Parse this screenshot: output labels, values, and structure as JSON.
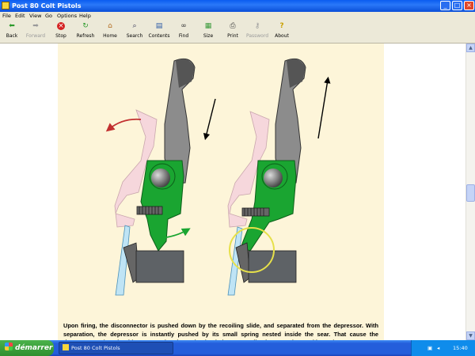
{
  "window": {
    "title": "Post 80 Colt Pistols"
  },
  "menu": [
    "File",
    "Edit",
    "View",
    "Go",
    "Options",
    "Help"
  ],
  "toolbar": [
    {
      "label": "Back",
      "icon": "back-arrow-icon",
      "enabled": true
    },
    {
      "label": "Forward",
      "icon": "forward-arrow-icon",
      "enabled": false
    },
    {
      "label": "Stop",
      "icon": "stop-icon",
      "enabled": true
    },
    {
      "label": "Refresh",
      "icon": "refresh-icon",
      "enabled": true
    },
    {
      "label": "Home",
      "icon": "home-icon",
      "enabled": true
    },
    {
      "label": "Search",
      "icon": "search-icon",
      "enabled": true
    },
    {
      "label": "Contents",
      "icon": "contents-icon",
      "enabled": true
    },
    {
      "label": "Find",
      "icon": "binoculars-icon",
      "enabled": true
    },
    {
      "label": "Size",
      "icon": "size-icon",
      "enabled": true
    },
    {
      "label": "Print",
      "icon": "printer-icon",
      "enabled": true
    },
    {
      "label": "Password",
      "icon": "key-icon",
      "enabled": false
    },
    {
      "label": "About",
      "icon": "about-icon",
      "enabled": true
    }
  ],
  "content": {
    "paragraph": "Upon firing, the disconnector is pushed down by the recoiling slide, and separated from the depressor. With separation, the depressor is instantly pushed by its small spring nested inside the sear. That cause the depressor's other shoulder, opposed to the spring loaded one, to strike the sear's leg, and keep the"
  },
  "taskbar": {
    "start_label": "démarrer",
    "task_label": "Post 80 Colt Pistols",
    "language": "FR",
    "clock": "15:40"
  },
  "colors": {
    "page_background": "#fdf5d9",
    "part_green": "#1aa531",
    "part_gray": "#777777",
    "arrow_red": "#c23030",
    "highlight_circle": "#e6e04a"
  }
}
